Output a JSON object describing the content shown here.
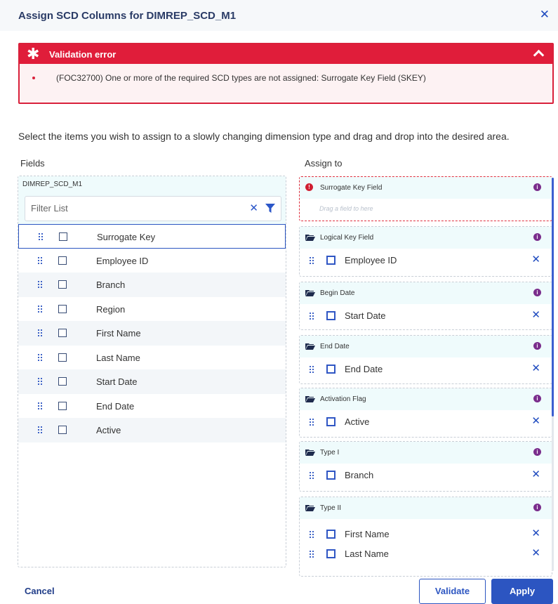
{
  "dialog": {
    "title": "Assign SCD Columns for DIMREP_SCD_M1",
    "close_icon": "close-icon"
  },
  "error": {
    "heading": "Validation error",
    "message": "(FOC32700) One or more of the required SCD types are not assigned: Surrogate Key Field (SKEY)",
    "color": "#e01d3a"
  },
  "instruction": "Select the items you wish to assign to a slowly changing dimension type and drag and drop into the desired area.",
  "fields": {
    "label": "Fields",
    "source": "DIMREP_SCD_M1",
    "filter_placeholder": "Filter List",
    "items": [
      "Surrogate Key",
      "Employee ID",
      "Branch",
      "Region",
      "First Name",
      "Last Name",
      "Start Date",
      "End Date",
      "Active"
    ]
  },
  "assign": {
    "label": "Assign to",
    "drop_hint": "Drag a field to here",
    "groups": [
      {
        "name": "Surrogate Key Field",
        "items": []
      },
      {
        "name": "Logical Key Field",
        "items": [
          "Employee ID"
        ]
      },
      {
        "name": "Begin Date",
        "items": [
          "Start Date"
        ]
      },
      {
        "name": "End Date",
        "items": [
          "End Date"
        ]
      },
      {
        "name": "Activation Flag",
        "items": [
          "Active"
        ]
      },
      {
        "name": "Type I",
        "items": [
          "Branch"
        ]
      },
      {
        "name": "Type II",
        "items": [
          "First Name",
          "Last Name"
        ]
      }
    ]
  },
  "footer": {
    "cancel": "Cancel",
    "validate": "Validate",
    "apply": "Apply"
  },
  "colors": {
    "accent": "#2c55c1",
    "info": "#7a2d8c",
    "panel_header": "#effbfc"
  }
}
